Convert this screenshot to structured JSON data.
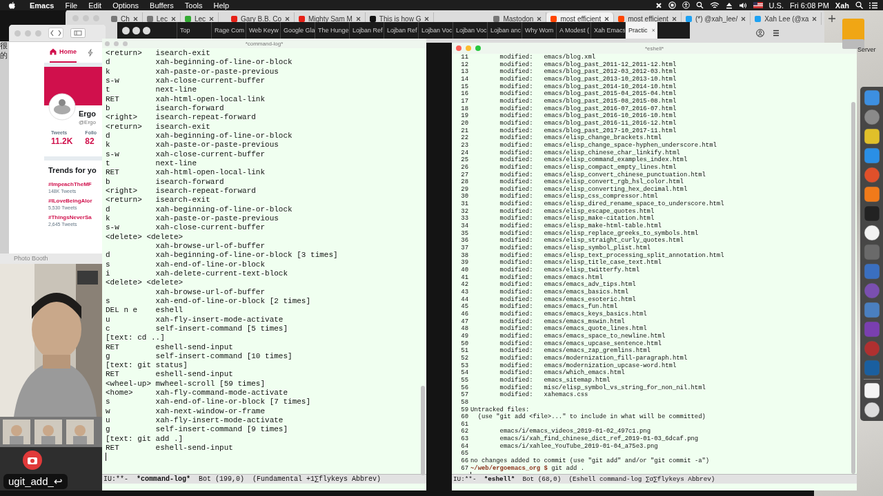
{
  "menu_bar": {
    "app": "Emacs",
    "menus": [
      "File",
      "Edit",
      "Options",
      "Buffers",
      "Tools",
      "Help"
    ],
    "input_source": "U.S.",
    "clock": "Fri 6:08 PM",
    "user": "Xah"
  },
  "desktop": {
    "drive_label": "Server",
    "side_text": [
      "很",
      "的"
    ]
  },
  "back_browser": {
    "tabs": [
      {
        "title": "Ch",
        "kind": "page",
        "selected": false
      },
      {
        "title": "Lec",
        "kind": "page",
        "selected": false
      },
      {
        "title": "Lec",
        "kind": "leaf",
        "selected": false
      },
      {
        "title": "Gary B.B. Co",
        "kind": "video",
        "selected": false
      },
      {
        "title": "Mighty Sam M",
        "kind": "video",
        "selected": false
      },
      {
        "title": "This is how G",
        "kind": "medium",
        "selected": false
      },
      {
        "title": "Mastodon",
        "kind": "page",
        "selected": false
      },
      {
        "title": "most efficient",
        "kind": "reddit",
        "selected": true
      },
      {
        "title": "most efficient",
        "kind": "reddit",
        "selected": false
      },
      {
        "title": "(*) @xah_lee/",
        "kind": "bird",
        "selected": false
      },
      {
        "title": "Xah Lee (@xa",
        "kind": "bird",
        "selected": false
      }
    ]
  },
  "browser": {
    "tabs": [
      {
        "title": "Top",
        "selected": false
      },
      {
        "title": "Rage Com",
        "selected": false
      },
      {
        "title": "Web Keyw",
        "selected": false
      },
      {
        "title": "Google Gla",
        "selected": false
      },
      {
        "title": "The Hunge",
        "selected": false
      },
      {
        "title": "Lojban Ref",
        "selected": false
      },
      {
        "title": "Lojban Ref",
        "selected": false
      },
      {
        "title": "Lojban Voc",
        "selected": false
      },
      {
        "title": "Lojban Voc",
        "selected": false
      },
      {
        "title": "Lojban anc",
        "selected": false
      },
      {
        "title": "Why Wom",
        "selected": false
      },
      {
        "title": "A Modest (",
        "selected": false
      },
      {
        "title": "Xah Emacs",
        "selected": false
      },
      {
        "title": "Practic",
        "selected": true
      }
    ]
  },
  "twitter": {
    "nav": [
      {
        "label": "Home",
        "selected": true
      }
    ],
    "profile": {
      "name": "Ergo",
      "handle": "@Ergo",
      "stats": [
        {
          "label": "Tweets",
          "value": "11.2K"
        },
        {
          "label": "Follo",
          "value": "82"
        }
      ]
    },
    "trends": {
      "title": "Trends for yo",
      "items": [
        {
          "tag": "#ImpeachTheMF",
          "count": "148K Tweets"
        },
        {
          "tag": "#ILoveBeingAlor",
          "count": "5,530 Tweets"
        },
        {
          "tag": "#ThingsNeverSa",
          "count": "2,645 Tweets"
        }
      ]
    }
  },
  "photo_booth": {
    "title": "Photo Booth",
    "keycast": "ugit_add_↩"
  },
  "command_log": {
    "title": "*command-log*",
    "rows": [
      {
        "key": "<return>",
        "command": "isearch-exit"
      },
      {
        "key": "d",
        "command": "xah-beginning-of-line-or-block"
      },
      {
        "key": "k",
        "command": "xah-paste-or-paste-previous"
      },
      {
        "key": "s-w",
        "command": "xah-close-current-buffer"
      },
      {
        "key": "t",
        "command": "next-line"
      },
      {
        "key": "RET",
        "command": "xah-html-open-local-link"
      },
      {
        "key": "b",
        "command": "isearch-forward"
      },
      {
        "key": "<right>",
        "command": "isearch-repeat-forward"
      },
      {
        "key": "<return>",
        "command": "isearch-exit"
      },
      {
        "key": "d",
        "command": "xah-beginning-of-line-or-block"
      },
      {
        "key": "k",
        "command": "xah-paste-or-paste-previous"
      },
      {
        "key": "s-w",
        "command": "xah-close-current-buffer"
      },
      {
        "key": "t",
        "command": "next-line"
      },
      {
        "key": "RET",
        "command": "xah-html-open-local-link"
      },
      {
        "key": "b",
        "command": "isearch-forward"
      },
      {
        "key": "<right>",
        "command": "isearch-repeat-forward"
      },
      {
        "key": "<return>",
        "command": "isearch-exit"
      },
      {
        "key": "d",
        "command": "xah-beginning-of-line-or-block"
      },
      {
        "key": "k",
        "command": "xah-paste-or-paste-previous"
      },
      {
        "key": "s-w",
        "command": "xah-close-current-buffer"
      },
      {
        "key": "<delete> <delete>"
      },
      {
        "command": "xah-browse-url-of-buffer"
      },
      {
        "key": "d",
        "command": "xah-beginning-of-line-or-block [3 times]"
      },
      {
        "key": "s",
        "command": "xah-end-of-line-or-block"
      },
      {
        "key": "i",
        "command": "xah-delete-current-text-block"
      },
      {
        "key": "<delete> <delete>"
      },
      {
        "command": "xah-browse-url-of-buffer"
      },
      {
        "key": "s",
        "command": "xah-end-of-line-or-block [2 times]"
      },
      {
        "key": "DEL n e",
        "command": "eshell"
      },
      {
        "key": "u",
        "command": "xah-fly-insert-mode-activate"
      },
      {
        "key": "c",
        "command": "self-insert-command [5 times]"
      },
      {
        "key": "[text: cd ..]"
      },
      {
        "key": "RET",
        "command": "eshell-send-input"
      },
      {
        "key": "g",
        "command": "self-insert-command [10 times]"
      },
      {
        "key": "[text: git status]"
      },
      {
        "key": "RET",
        "command": "eshell-send-input"
      },
      {
        "key": "<wheel-up>",
        "command": "mwheel-scroll [59 times]"
      },
      {
        "key": "<home>",
        "command": "xah-fly-command-mode-activate"
      },
      {
        "key": "s",
        "command": "xah-end-of-line-or-block [7 times]"
      },
      {
        "key": "w",
        "command": "xah-next-window-or-frame"
      },
      {
        "key": "u",
        "command": "xah-fly-insert-mode-activate"
      },
      {
        "key": "g",
        "command": "self-insert-command [9 times]"
      },
      {
        "key": "[text: git add .]"
      },
      {
        "key": "RET",
        "command": "eshell-send-input"
      }
    ],
    "mode_line": {
      "status": "IU:**-",
      "buffer": "*command-log*",
      "position": "Bot (199,0)",
      "modes": "(Fundamental +1∑flykeys Abbrev)"
    }
  },
  "eshell": {
    "title": "*eshell*",
    "lines": [
      {
        "n": "11",
        "kind": "modified",
        "status": "modified:",
        "path": "emacs/blog.xml"
      },
      {
        "n": "12",
        "kind": "modified",
        "status": "modified:",
        "path": "emacs/blog_past_2011-12_2011-12.html"
      },
      {
        "n": "13",
        "kind": "modified",
        "status": "modified:",
        "path": "emacs/blog_past_2012-03_2012-03.html"
      },
      {
        "n": "14",
        "kind": "modified",
        "status": "modified:",
        "path": "emacs/blog_past_2013-10_2013-10.html"
      },
      {
        "n": "15",
        "kind": "modified",
        "status": "modified:",
        "path": "emacs/blog_past_2014-10_2014-10.html"
      },
      {
        "n": "16",
        "kind": "modified",
        "status": "modified:",
        "path": "emacs/blog_past_2015-04_2015-04.html"
      },
      {
        "n": "17",
        "kind": "modified",
        "status": "modified:",
        "path": "emacs/blog_past_2015-08_2015-08.html"
      },
      {
        "n": "18",
        "kind": "modified",
        "status": "modified:",
        "path": "emacs/blog_past_2016-07_2016-07.html"
      },
      {
        "n": "19",
        "kind": "modified",
        "status": "modified:",
        "path": "emacs/blog_past_2016-10_2016-10.html"
      },
      {
        "n": "20",
        "kind": "modified",
        "status": "modified:",
        "path": "emacs/blog_past_2016-11_2016-12.html"
      },
      {
        "n": "21",
        "kind": "modified",
        "status": "modified:",
        "path": "emacs/blog_past_2017-10_2017-11.html"
      },
      {
        "n": "22",
        "kind": "modified",
        "status": "modified:",
        "path": "emacs/elisp_change_brackets.html"
      },
      {
        "n": "23",
        "kind": "modified",
        "status": "modified:",
        "path": "emacs/elisp_change_space-hyphen_underscore.html"
      },
      {
        "n": "24",
        "kind": "modified",
        "status": "modified:",
        "path": "emacs/elisp_chinese_char_linkify.html"
      },
      {
        "n": "25",
        "kind": "modified",
        "status": "modified:",
        "path": "emacs/elisp_command_examples_index.html"
      },
      {
        "n": "26",
        "kind": "modified",
        "status": "modified:",
        "path": "emacs/elisp_compact_empty_lines.html"
      },
      {
        "n": "27",
        "kind": "modified",
        "status": "modified:",
        "path": "emacs/elisp_convert_chinese_punctuation.html"
      },
      {
        "n": "28",
        "kind": "modified",
        "status": "modified:",
        "path": "emacs/elisp_convert_rgb_hsl_color.html"
      },
      {
        "n": "29",
        "kind": "modified",
        "status": "modified:",
        "path": "emacs/elisp_converting_hex_decimal.html"
      },
      {
        "n": "30",
        "kind": "modified",
        "status": "modified:",
        "path": "emacs/elisp_css_compressor.html"
      },
      {
        "n": "31",
        "kind": "modified",
        "status": "modified:",
        "path": "emacs/elisp_dired_rename_space_to_underscore.html"
      },
      {
        "n": "32",
        "kind": "modified",
        "status": "modified:",
        "path": "emacs/elisp_escape_quotes.html"
      },
      {
        "n": "33",
        "kind": "modified",
        "status": "modified:",
        "path": "emacs/elisp_make-citation.html"
      },
      {
        "n": "34",
        "kind": "modified",
        "status": "modified:",
        "path": "emacs/elisp_make-html-table.html"
      },
      {
        "n": "35",
        "kind": "modified",
        "status": "modified:",
        "path": "emacs/elisp_replace_greeks_to_symbols.html"
      },
      {
        "n": "36",
        "kind": "modified",
        "status": "modified:",
        "path": "emacs/elisp_straight_curly_quotes.html"
      },
      {
        "n": "37",
        "kind": "modified",
        "status": "modified:",
        "path": "emacs/elisp_symbol_plist.html"
      },
      {
        "n": "38",
        "kind": "modified",
        "status": "modified:",
        "path": "emacs/elisp_text_processing_split_annotation.html"
      },
      {
        "n": "39",
        "kind": "modified",
        "status": "modified:",
        "path": "emacs/elisp_title_case_text.html"
      },
      {
        "n": "40",
        "kind": "modified",
        "status": "modified:",
        "path": "emacs/elisp_twitterfy.html"
      },
      {
        "n": "41",
        "kind": "modified",
        "status": "modified:",
        "path": "emacs/emacs.html"
      },
      {
        "n": "42",
        "kind": "modified",
        "status": "modified:",
        "path": "emacs/emacs_adv_tips.html"
      },
      {
        "n": "43",
        "kind": "modified",
        "status": "modified:",
        "path": "emacs/emacs_basics.html"
      },
      {
        "n": "44",
        "kind": "modified",
        "status": "modified:",
        "path": "emacs/emacs_esoteric.html"
      },
      {
        "n": "45",
        "kind": "modified",
        "status": "modified:",
        "path": "emacs/emacs_fun.html"
      },
      {
        "n": "46",
        "kind": "modified",
        "status": "modified:",
        "path": "emacs/emacs_keys_basics.html"
      },
      {
        "n": "47",
        "kind": "modified",
        "status": "modified:",
        "path": "emacs/emacs_mswin.html"
      },
      {
        "n": "48",
        "kind": "modified",
        "status": "modified:",
        "path": "emacs/emacs_quote_lines.html"
      },
      {
        "n": "49",
        "kind": "modified",
        "status": "modified:",
        "path": "emacs/emacs_space_to_newline.html"
      },
      {
        "n": "50",
        "kind": "modified",
        "status": "modified:",
        "path": "emacs/emacs_upcase_sentence.html"
      },
      {
        "n": "51",
        "kind": "modified",
        "status": "modified:",
        "path": "emacs/emacs_zap_gremlins.html"
      },
      {
        "n": "52",
        "kind": "modified",
        "status": "modified:",
        "path": "emacs/modernization_fill-paragraph.html"
      },
      {
        "n": "53",
        "kind": "modified",
        "status": "modified:",
        "path": "emacs/modernization_upcase-word.html"
      },
      {
        "n": "54",
        "kind": "modified",
        "status": "modified:",
        "path": "emacs/which_emacs.html"
      },
      {
        "n": "55",
        "kind": "modified",
        "status": "modified:",
        "path": "emacs_sitemap.html"
      },
      {
        "n": "56",
        "kind": "modified",
        "status": "modified:",
        "path": "misc/elisp_symbol_vs_string_for_non_nil.html"
      },
      {
        "n": "57",
        "kind": "modified",
        "status": "modified:",
        "path": "xahemacs.css"
      },
      {
        "n": "58",
        "kind": "blank"
      },
      {
        "n": "59",
        "kind": "text",
        "text": "Untracked files:"
      },
      {
        "n": "60",
        "kind": "hint",
        "text": "(use \"git add <file>...\" to include in what will be committed)"
      },
      {
        "n": "61",
        "kind": "blank"
      },
      {
        "n": "62",
        "kind": "untracked",
        "path": "emacs/i/emacs_videos_2019-01-02_497c1.png"
      },
      {
        "n": "63",
        "kind": "untracked",
        "path": "emacs/i/xah_find_chinese_dict_ref_2019-01-03_6dcaf.png"
      },
      {
        "n": "64",
        "kind": "untracked",
        "path": "emacs/i/xahlee_YouTube_2019-01-04_a75e3.png"
      },
      {
        "n": "65",
        "kind": "blank"
      },
      {
        "n": "66",
        "kind": "text",
        "text": "no changes added to commit (use \"git add\" and/or \"git commit -a\")"
      },
      {
        "n": "67",
        "kind": "prompt",
        "prompt": "~/web/ergoemacs_org $",
        "text": "git add ."
      }
    ],
    "mode_line": {
      "status": "IU:**-",
      "buffer": "*eshell*",
      "position": "Bot (68,0)",
      "modes": "(Eshell command-log ∑α∑flykeys Abbrev)"
    }
  }
}
